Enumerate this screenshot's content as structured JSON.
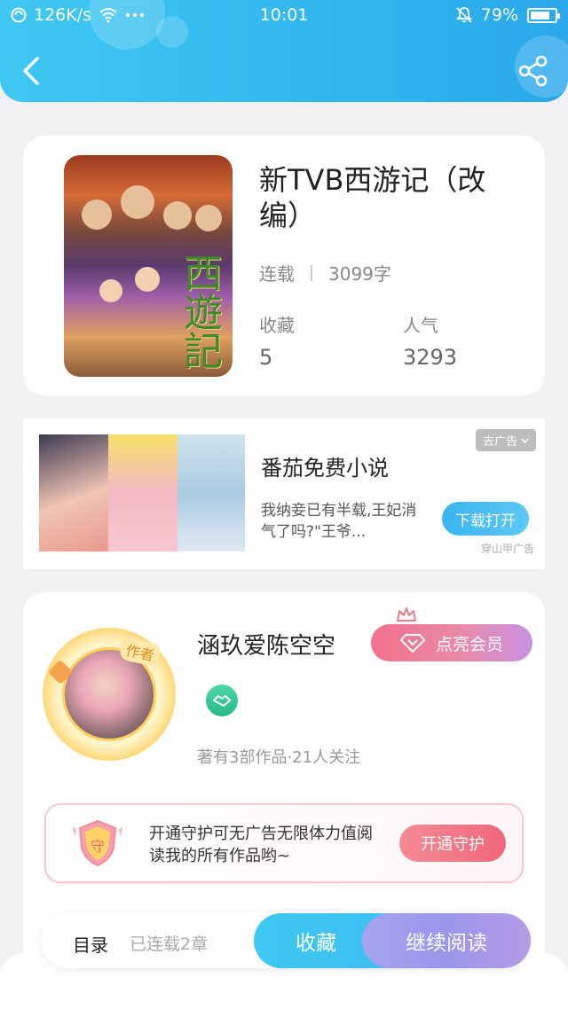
{
  "status_bar": {
    "net_speed": "126K/s",
    "time": "10:01",
    "battery": "79%",
    "battery_level": 0.79,
    "icons": [
      "wifi-icon",
      "more-dots-icon",
      "mute-bell-icon",
      "battery-icon"
    ]
  },
  "header": {
    "back_icon": "back-arrow-icon",
    "share_icon": "share-icon",
    "gradient": [
      "#3fc8f2",
      "#2aa8ea"
    ]
  },
  "book": {
    "title": "新TVB西游记（改编）",
    "status": "连载",
    "word_count": "3099字",
    "stats": [
      {
        "label": "收藏",
        "value": "5"
      },
      {
        "label": "人气",
        "value": "3293"
      }
    ],
    "cover_calligraphy": "西遊記"
  },
  "ad": {
    "title": "番茄免费小说",
    "description": "我纳妾已有半载,王妃消气了吗?\"王爷...",
    "close_label": "去广告",
    "download_label": "下载打开",
    "source": "穿山甲广告",
    "accent": "#39b5ef"
  },
  "author": {
    "name": "涵玖爱陈空空",
    "badge": "作者",
    "vip_label": "点亮会员",
    "stats": "著有3部作品·21人关注",
    "guard": {
      "text": "开通守护可无广告无限体力值阅读我的所有作品哟~",
      "shield_char": "守",
      "button": "开通守护"
    }
  },
  "bottom_bar": {
    "toc_label": "目录",
    "chapter_count": "已连载2章",
    "favorite_label": "收藏",
    "read_label": "继续阅读"
  }
}
